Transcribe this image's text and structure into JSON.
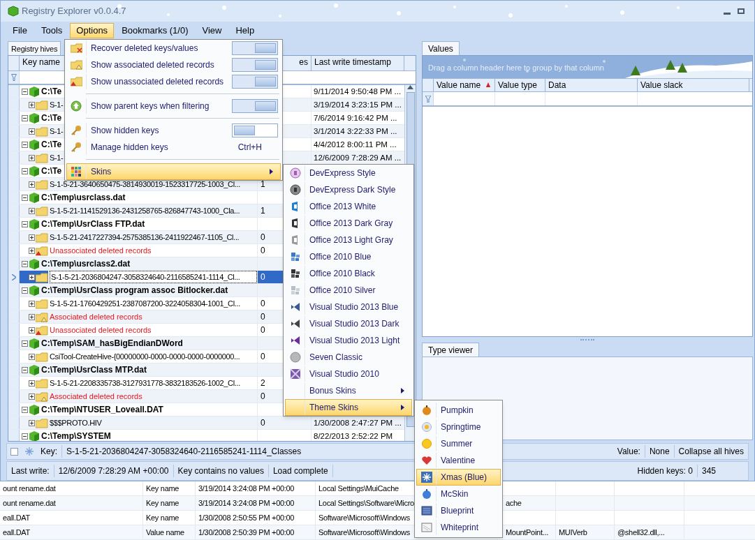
{
  "window": {
    "title": "Registry Explorer v0.0.4.7"
  },
  "menu_bar": [
    {
      "label": "File",
      "selected": false
    },
    {
      "label": "Tools",
      "selected": false
    },
    {
      "label": "Options",
      "selected": true
    },
    {
      "label": "Bookmarks (1/0)",
      "selected": false
    },
    {
      "label": "View",
      "selected": false
    },
    {
      "label": "Help",
      "selected": false
    }
  ],
  "hives_panel": {
    "tab": "Registry hives",
    "columns": [
      "Key name",
      "es",
      "Last write timestamp"
    ],
    "rows": [
      {
        "kind": "hive",
        "name": "C:\\Te",
        "timestamp": "9/11/2014 9:50:48 PM ...",
        "selected": false
      },
      {
        "kind": "key",
        "name": "S-1-",
        "timestamp": "3/19/2014 3:23:15 PM ...",
        "selected": false
      },
      {
        "kind": "hive",
        "name": "C:\\Te",
        "timestamp": "7/6/2014 9:16:42 PM ...",
        "selected": false
      },
      {
        "kind": "key",
        "name": "S-1-",
        "timestamp": "3/1/2014 3:22:33 PM ...",
        "selected": false
      },
      {
        "kind": "hive",
        "name": "C:\\Te",
        "timestamp": "4/4/2012 8:00:11 PM ...",
        "selected": false
      },
      {
        "kind": "key",
        "name": "S-1-",
        "timestamp": "12/6/2009 7:28:29 AM ...",
        "selected": false
      },
      {
        "kind": "hive",
        "name": "C:\\Te",
        "selected": false
      },
      {
        "kind": "key",
        "name": "S-1-5-21-3640650475-3814930019-1523317725-1003_Cl...",
        "values": "1",
        "selected": false
      },
      {
        "kind": "hive",
        "name": "C:\\Temp\\usrclass.dat",
        "selected": false
      },
      {
        "kind": "key",
        "name": "S-1-5-21-1141529136-2431258765-826847743-1000_Cla...",
        "values": "1",
        "selected": false
      },
      {
        "kind": "hive",
        "name": "C:\\Temp\\UsrClass FTP.dat",
        "selected": false
      },
      {
        "kind": "key",
        "name": "S-1-5-21-2417227394-2575385136-2411922467-1105_Cl...",
        "values": "0",
        "selected": false
      },
      {
        "kind": "unassoc",
        "name": "Unassociated deleted records",
        "values": "0",
        "selected": false
      },
      {
        "kind": "hive",
        "name": "C:\\Temp\\usrclass2.dat",
        "selected": false
      },
      {
        "kind": "key",
        "name": "S-1-5-21-2036804247-3058324640-2116585241-1114_Cl...",
        "values": "0",
        "selected": true
      },
      {
        "kind": "hive",
        "name": "C:\\Temp\\UsrClass program assoc Bitlocker.dat",
        "selected": false
      },
      {
        "kind": "key",
        "name": "S-1-5-21-1760429251-2387087200-3224058304-1001_Cl...",
        "values": "0",
        "selected": false
      },
      {
        "kind": "assoc",
        "name": "Associated deleted records",
        "values": "0",
        "selected": false
      },
      {
        "kind": "unassoc",
        "name": "Unassociated deleted records",
        "values": "0",
        "selected": false
      },
      {
        "kind": "hive",
        "name": "C:\\Temp\\SAM_hasBigEndianDWord",
        "selected": false
      },
      {
        "kind": "key",
        "name": "CsiTool-CreateHive-{00000000-0000-0000-0000-0000000...",
        "values": "0",
        "selected": false
      },
      {
        "kind": "hive",
        "name": "C:\\Temp\\UsrClass MTP.dat",
        "selected": false
      },
      {
        "kind": "key",
        "name": "S-1-5-21-2208335738-3127931778-3832183526-1002_Cl...",
        "values": "2",
        "selected": false
      },
      {
        "kind": "assoc",
        "name": "Associated deleted records",
        "values": "0",
        "selected": false
      },
      {
        "kind": "hive",
        "name": "C:\\Temp\\NTUSER_Loveall.DAT",
        "selected": false
      },
      {
        "kind": "key",
        "name": "$$$PROTO.HIV",
        "values": "0",
        "timestamp": "1/30/2008 2:47:27 PM ...",
        "selected": false
      },
      {
        "kind": "hive",
        "name": "C:\\Temp\\SYSTEM",
        "timestamp": "8/22/2013 2:52:22 PM",
        "selected": false
      }
    ]
  },
  "values_panel": {
    "tab": "Values",
    "group_hint": "Drag a column header here to group by that column",
    "columns": [
      "Value name",
      "Value type",
      "Data",
      "Value slack"
    ]
  },
  "type_viewer": {
    "tab": "Type viewer"
  },
  "key_bar": {
    "checked": false,
    "label": "Key:",
    "key": "S-1-5-21-2036804247-3058324640-2116585241-1114_Classes",
    "value_label": "Value:",
    "value": "None",
    "button": "Collapse all hives"
  },
  "status_bar": {
    "last_write_label": "Last write:",
    "last_write": "12/6/2009 7:28:29 AM +00:00",
    "values_note": "Key contains no values",
    "load": "Load complete",
    "hidden_keys": "Hidden keys: 0",
    "count": "345"
  },
  "options_menu": [
    {
      "kind": "toggle",
      "label": "Recover deleted keys/values",
      "on": true,
      "highlighted": false
    },
    {
      "kind": "toggle",
      "label": "Show associated deleted records",
      "on": true,
      "highlighted": false
    },
    {
      "kind": "toggle",
      "label": "Show unassociated deleted records",
      "on": true,
      "highlighted": false
    },
    {
      "kind": "separator"
    },
    {
      "kind": "toggle",
      "label": "Show parent keys when filtering",
      "on": true,
      "highlighted": false
    },
    {
      "kind": "separator"
    },
    {
      "kind": "toggle",
      "label": "Show hidden keys",
      "on": false,
      "highlighted": false
    },
    {
      "kind": "shortcut",
      "label": "Manage hidden keys",
      "shortcut": "Ctrl+H",
      "highlighted": false
    },
    {
      "kind": "separator"
    },
    {
      "kind": "submenu",
      "label": "Skins",
      "highlighted": true
    }
  ],
  "skins_menu": [
    {
      "label": "DevExpress Style",
      "highlighted": false
    },
    {
      "label": "DevExpress Dark Style",
      "highlighted": false
    },
    {
      "label": "Office 2013 White",
      "highlighted": false
    },
    {
      "label": "Office 2013 Dark Gray",
      "highlighted": false
    },
    {
      "label": "Office 2013 Light Gray",
      "highlighted": false
    },
    {
      "label": "Office 2010 Blue",
      "highlighted": false
    },
    {
      "label": "Office 2010 Black",
      "highlighted": false
    },
    {
      "label": "Office 2010 Silver",
      "highlighted": false
    },
    {
      "label": "Visual Studio 2013 Blue",
      "highlighted": false
    },
    {
      "label": "Visual Studio 2013 Dark",
      "highlighted": false
    },
    {
      "label": "Visual Studio 2013 Light",
      "highlighted": false
    },
    {
      "label": "Seven Classic",
      "highlighted": false
    },
    {
      "label": "Visual Studio 2010",
      "highlighted": false
    },
    {
      "label": "Bonus Skins",
      "submenu": true,
      "highlighted": false
    },
    {
      "label": "Theme Skins",
      "submenu": true,
      "highlighted": true
    }
  ],
  "theme_skins_menu": [
    {
      "label": "Pumpkin",
      "selected": false
    },
    {
      "label": "Springtime",
      "selected": false
    },
    {
      "label": "Summer",
      "selected": false
    },
    {
      "label": "Valentine",
      "selected": false
    },
    {
      "label": "Xmas (Blue)",
      "selected": true
    },
    {
      "label": "McSkin",
      "selected": false
    },
    {
      "label": "Blueprint",
      "selected": false
    },
    {
      "label": "Whiteprint",
      "selected": false
    }
  ],
  "background_window": {
    "rows": [
      [
        "ount rename.dat",
        "Key name",
        "3/19/2014 3:24:08 PM +00:00",
        "Local Settings\\MuiCache",
        "",
        "",
        ""
      ],
      [
        "ount rename.dat",
        "Key name",
        "3/19/2014 3:24:08 PM +00:00",
        "Local Settings\\Software\\Micro",
        "ache",
        "",
        ""
      ],
      [
        "eall.DAT",
        "Key name",
        "1/30/2008 2:50:55 PM +00:00",
        "Software\\Microsoft\\Windows",
        "",
        "",
        ""
      ],
      [
        "eall.DAT",
        "Value name",
        "1/30/2008 2:50:39 PM +00:00",
        "Software\\Microsoft\\Windows",
        "MountPoint...",
        "MUIVerb",
        "@shell32.dll,..."
      ]
    ]
  }
}
